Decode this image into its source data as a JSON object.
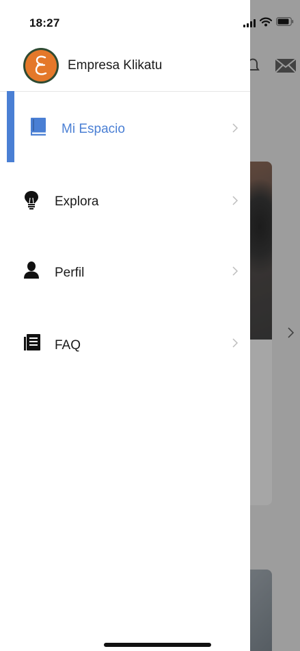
{
  "status_bar": {
    "time": "18:27"
  },
  "drawer": {
    "company_name": "Empresa Klikatu",
    "avatar_letter": "E",
    "items": [
      {
        "label": "Mi Espacio",
        "icon": "book-icon",
        "active": true
      },
      {
        "label": "Explora",
        "icon": "lightbulb-icon",
        "active": false
      },
      {
        "label": "Perfil",
        "icon": "person-icon",
        "active": false
      },
      {
        "label": "FAQ",
        "icon": "document-list-icon",
        "active": false
      }
    ]
  },
  "background_app": {
    "header_icons": [
      "bell-icon",
      "mail-icon"
    ]
  },
  "colors": {
    "accent": "#4a7fd4",
    "avatar_fill": "#e4782a",
    "avatar_ring": "#2e4a32",
    "overlay": "rgba(0,0,0,0.35)"
  }
}
